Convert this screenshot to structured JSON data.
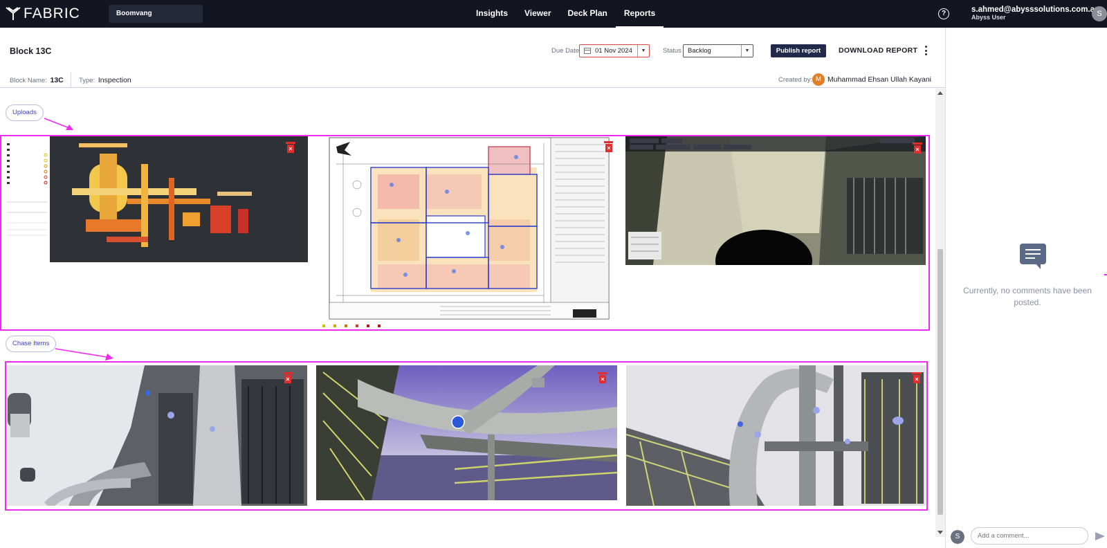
{
  "brand": {
    "name": "FABRIC"
  },
  "project": {
    "selected": "Boomvang"
  },
  "nav": {
    "items": [
      {
        "label": "Insights"
      },
      {
        "label": "Viewer"
      },
      {
        "label": "Deck Plan"
      },
      {
        "label": "Reports",
        "active": true
      }
    ]
  },
  "user": {
    "email": "s.ahmed@abysssolutions.com.au",
    "role": "Abyss User",
    "initial": "S"
  },
  "report": {
    "title": "Block 13C",
    "due_label": "Due Date",
    "due_value": "01 Nov 2024",
    "status_label": "Status",
    "status_value": "Backlog",
    "publish_label": "Publish report",
    "download_label": "DOWNLOAD REPORT",
    "block_name_label": "Block Name:",
    "block_name_value": "13C",
    "type_label": "Type:",
    "type_value": "Inspection",
    "created_label": "Created by:",
    "created_initial": "M",
    "created_name": "Muhammad Ehsan Ullah Kayani"
  },
  "sections": {
    "uploads_label": "Uploads",
    "chase_label": "Chase Items",
    "uploads": [
      {
        "name": "3d-point-cloud-view"
      },
      {
        "name": "deck-plan-drawing"
      },
      {
        "name": "panorama-viewer"
      }
    ],
    "chase_items": [
      {
        "name": "chase-photo-1"
      },
      {
        "name": "chase-photo-2"
      },
      {
        "name": "chase-photo-3"
      }
    ]
  },
  "comments": {
    "empty_text": "Currently, no comments have been posted.",
    "input_placeholder": "Add a comment...",
    "user_initial": "S"
  },
  "colors": {
    "topbar": "#131521",
    "publish_button": "#1f2a4a",
    "highlight": "#ee2af0",
    "delete": "#e02d2d"
  }
}
